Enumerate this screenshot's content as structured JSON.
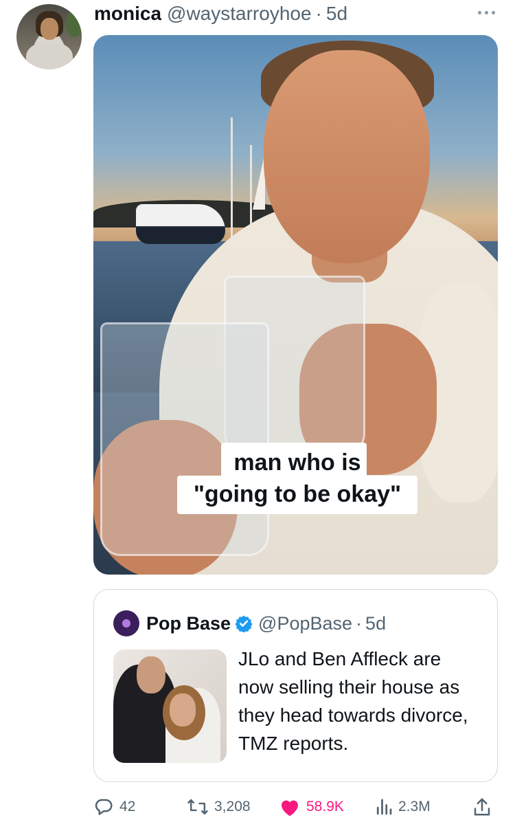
{
  "post": {
    "author_name": "monica",
    "author_handle": "@waystarroyhoe",
    "separator": "·",
    "age": "5d",
    "image_caption": "man who is\n\"going to be okay\""
  },
  "quote": {
    "author_name": "Pop Base",
    "author_handle": "@PopBase",
    "separator": "·",
    "age": "5d",
    "text": "JLo and Ben Affleck are now selling their house as they head towards divorce, TMZ reports."
  },
  "actions": {
    "replies": "42",
    "reposts": "3,208",
    "likes": "58.9K",
    "views": "2.3M"
  },
  "colors": {
    "like": "#f91880",
    "verified": "#1d9bf0",
    "muted": "#536471"
  },
  "icons": [
    "more-icon",
    "verified-icon",
    "reply-icon",
    "repost-icon",
    "like-icon",
    "views-icon",
    "share-icon"
  ]
}
